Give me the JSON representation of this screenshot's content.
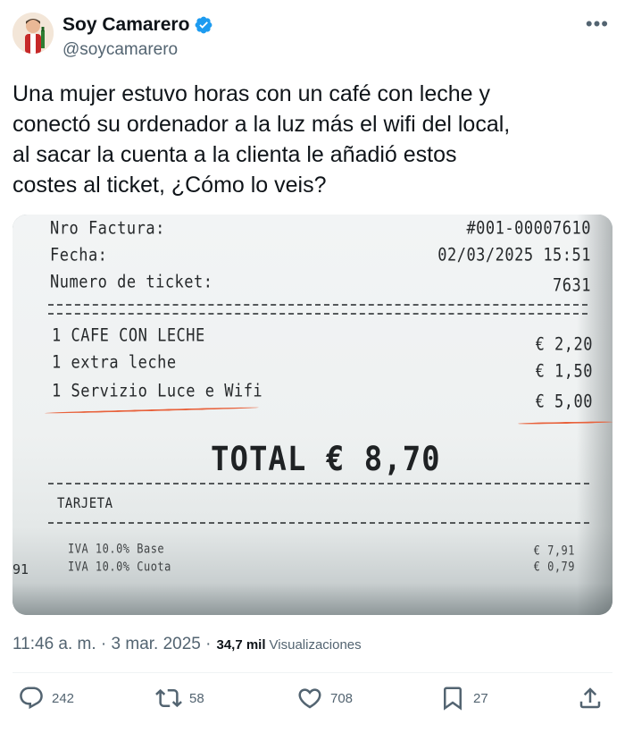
{
  "author": {
    "name": "Soy Camarero",
    "handle": "@soycamarero",
    "verified": true,
    "more_icon": "more-horizontal-icon"
  },
  "tweet": {
    "text": "Una mujer estuvo horas con un café con leche y\nconectó su ordenador a la luz más el wifi del local,\nal sacar la cuenta a la clienta le añadió estos\ncostes al ticket, ¿Cómo lo veis?"
  },
  "receipt": {
    "invoice_label": "Nro Factura:",
    "invoice_value": "#001-00007610",
    "date_label": "Fecha:",
    "date_value": "02/03/2025 15:51",
    "ticket_label": "Numero de ticket:",
    "ticket_value": "7631",
    "items": [
      {
        "desc": "1 CAFE CON LECHE",
        "price": "€ 2,20"
      },
      {
        "desc": "1 extra leche",
        "price": "€ 1,50"
      },
      {
        "desc": "1 Servizio Luce e Wifi",
        "price": "€ 5,00"
      }
    ],
    "total": "TOTAL € 8,70",
    "payment": "TARJETA",
    "iva_base_label": "IVA 10.0% Base",
    "iva_base_value": "€ 7,91",
    "iva_cuota_label": "IVA 10.0% Cuota",
    "iva_cuota_value": "€ 0,79",
    "edge_number": "91"
  },
  "meta": {
    "time": "11:46 a. m. · 3 mar. 2025 ·",
    "views_count": "34,7 mil",
    "views_label": "Visualizaciones"
  },
  "actions": {
    "replies": "242",
    "retweets": "58",
    "likes": "708",
    "bookmarks": "27"
  },
  "colors": {
    "text_primary": "#0f1419",
    "text_secondary": "#536471",
    "verified_blue": "#1d9bf0",
    "annotation_red": "#e8623c"
  }
}
